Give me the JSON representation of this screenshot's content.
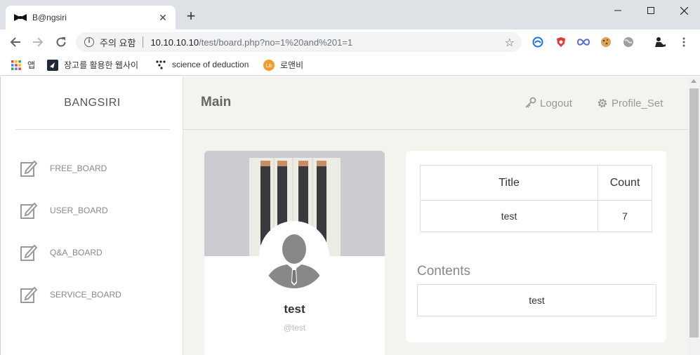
{
  "browser": {
    "tab_title": "B@ngsiri",
    "tab_close": "✕",
    "new_tab": "+",
    "security_label": "주의 요함",
    "url_host": "10.10.10.10",
    "url_path": "/test/board.php?no=1%20and%201=1",
    "star": "☆",
    "bookmarks": [
      {
        "label": "앱",
        "icon": "apps-grid-icon"
      },
      {
        "label": "장고를 활용한 웹사이",
        "icon": "django-bookmark-icon"
      },
      {
        "label": "science of deduction",
        "icon": "dots-bookmark-icon"
      },
      {
        "label": "로앤비",
        "icon": "lawnb-bookmark-icon"
      }
    ]
  },
  "sidebar": {
    "brand": "BANGSIRI",
    "items": [
      {
        "label": "FREE_BOARD",
        "icon": "edit-icon"
      },
      {
        "label": "USER_BOARD",
        "icon": "edit-icon"
      },
      {
        "label": "Q&A_BOARD",
        "icon": "edit-icon"
      },
      {
        "label": "SERVICE_BOARD",
        "icon": "edit-icon"
      }
    ]
  },
  "header": {
    "title": "Main",
    "logout_label": "Logout",
    "profile_label": "Profile_Set"
  },
  "profile": {
    "name": "test",
    "handle": "@test"
  },
  "board": {
    "headers": [
      "Title",
      "Count"
    ],
    "rows": [
      [
        "test",
        "7"
      ]
    ],
    "contents_label": "Contents",
    "contents_value": "test"
  }
}
